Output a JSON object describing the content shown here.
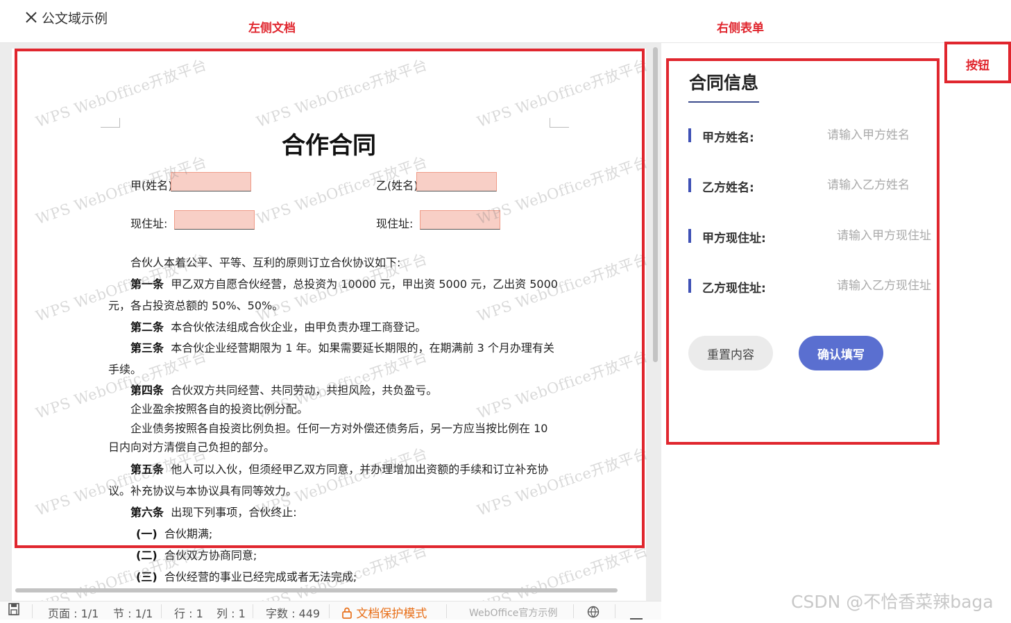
{
  "header": {
    "title": "公文域示例"
  },
  "annotations": {
    "left_doc": "左侧文档",
    "right_form": "右侧表单",
    "buttons": "按钮"
  },
  "document": {
    "watermark": "WPS WebOffice开放平台",
    "title": "合作合同",
    "party_a_name_label": "甲(姓名)",
    "party_b_name_label": "乙(姓名)",
    "address_label_a": "现住址:",
    "address_label_b": "现住址:",
    "intro": "合伙人本着公平、平等、互利的原则订立合伙协议如下:",
    "art1_head": "第一条",
    "art1_a": "甲乙双方自愿合伙经营，总投资为 10000 元，甲出资 5000 元，乙出资 5000",
    "art1_b": "元，各占投资总额的 50%、50%。",
    "art2_head": "第二条",
    "art2": "本合伙依法组成合伙企业，由甲负责办理工商登记。",
    "art3_head": "第三条",
    "art3_a": "本合伙企业经营期限为 1 年。如果需要延长期限的，在期满前 3 个月办理有关",
    "art3_b": "手续。",
    "art4_head": "第四条",
    "art4": "合伙双方共同经营、共同劳动，共担风险，共负盈亏。",
    "art4_p2": "企业盈余按照各自的投资比例分配。",
    "art4_p3a": "企业债务按照各自投资比例负担。任何一方对外偿还债务后，另一方应当按比例在 10",
    "art4_p3b": "日内向对方清偿自己负担的部分。",
    "art5_head": "第五条",
    "art5_a": "他人可以入伙，但须经甲乙双方同意，并办理增加出资额的手续和订立补充协",
    "art5_b": "议。补充协议与本协议具有同等效力。",
    "art6_head": "第六条",
    "art6": "出现下列事项，合伙终止:",
    "item1_head": "(一)",
    "item1": "合伙期满;",
    "item2_head": "(二)",
    "item2": "合伙双方协商同意;",
    "item3_head": "(三)",
    "item3": "合伙经营的事业已经完成或者无法完成;"
  },
  "form": {
    "title": "合同信息",
    "fields": [
      {
        "label": "甲方姓名:",
        "placeholder": "请输入甲方姓名",
        "value": ""
      },
      {
        "label": "乙方姓名:",
        "placeholder": "请输入乙方姓名",
        "value": ""
      },
      {
        "label": "甲方现住址:",
        "placeholder": "请输入甲方现住址",
        "value": ""
      },
      {
        "label": "乙方现住址:",
        "placeholder": "请输入乙方现住址",
        "value": ""
      }
    ],
    "reset_label": "重置内容",
    "confirm_label": "确认填写"
  },
  "statusbar": {
    "page": "页面 : 1/1",
    "section": "节 : 1/1",
    "row": "行 : 1",
    "col": "列 : 1",
    "word_count": "字数 : 449",
    "protect_mode": "文档保护模式",
    "brand": "WebOffice官方示例"
  },
  "footer_watermark": "CSDN @不恰香菜辣baga",
  "colors": {
    "annotation_red": "#e0262e",
    "confirm_button": "#5a6fd0",
    "reset_button": "#ebebeb",
    "label_bar": "#3f51b5",
    "field_highlight": "#f8cfc6",
    "protect_orange": "#e8701a"
  }
}
